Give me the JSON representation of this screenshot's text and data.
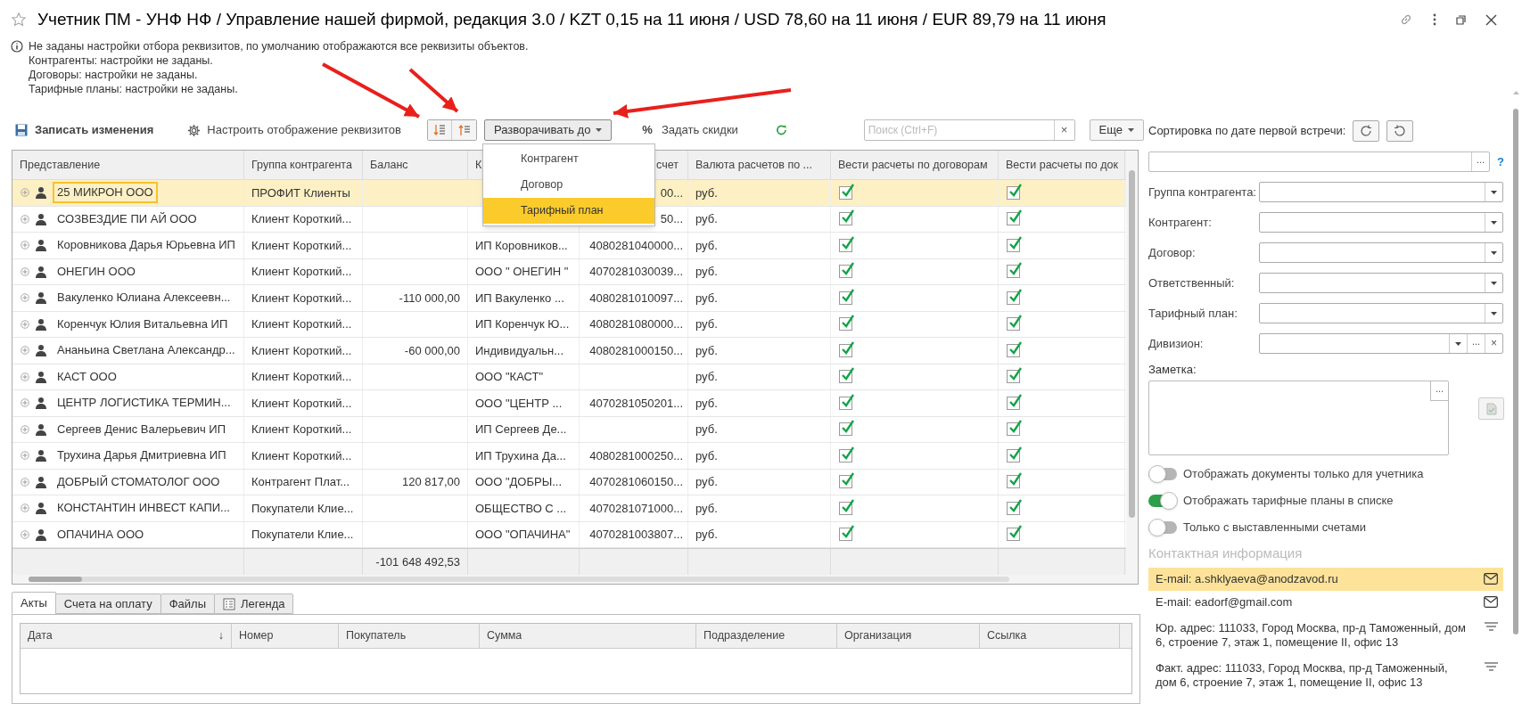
{
  "window": {
    "title": "Учетник ПМ - УНФ НФ / Управление нашей фирмой, редакция 3.0 / KZT 0,15 на 11 июня / USD 78,60 на 11 июня / EUR 89,79 на 11 июня"
  },
  "info_lines": [
    "Не заданы настройки отбора реквизитов, по умолчанию отображаются все реквизиты объектов.",
    "Контрагенты: настройки не заданы.",
    "Договоры: настройки не заданы.",
    "Тарифные планы: настройки не заданы."
  ],
  "toolbar": {
    "save": "Записать изменения",
    "settings": "Настроить отображение реквизитов",
    "expand": "Разворачивать до",
    "discount_mark": "%",
    "discounts": "Задать скидки",
    "search_placeholder": "Поиск (Ctrl+F)",
    "search_clear": "×",
    "more": "Еще"
  },
  "expand_menu": [
    {
      "label": "Контрагент",
      "selected": false
    },
    {
      "label": "Договор",
      "selected": false
    },
    {
      "label": "Тарифный план",
      "selected": true
    }
  ],
  "table": {
    "columns": [
      "Представление",
      "Группа контрагента",
      "Баланс",
      "К",
      "счет",
      "Валюта расчетов по ...",
      "Вести расчеты по договорам",
      "Вести расчеты по док"
    ],
    "rows": [
      {
        "name": "25 МИКРОН ООО",
        "group": "ПРОФИТ Клиенты",
        "balance": "",
        "column_5": "00...",
        "currency": "руб.",
        "by_contracts": true,
        "by_documents": true,
        "selected": true
      },
      {
        "name": "СОЗВЕЗДИЕ ПИ АЙ ООО",
        "group": "Клиент Короткий...",
        "balance": "",
        "column_5": "50...",
        "currency": "руб.",
        "by_contracts": true,
        "by_documents": true,
        "selected": false
      },
      {
        "name": "Коровникова Дарья Юрьевна ИП",
        "group": "Клиент Короткий...",
        "balance": "",
        "column_4": "ИП Коровников...",
        "column_5": "4080281040000...",
        "currency": "руб.",
        "by_contracts": true,
        "by_documents": true,
        "selected": false
      },
      {
        "name": "ОНЕГИН  ООО",
        "group": "Клиент Короткий...",
        "balance": "",
        "column_4": "ООО \" ОНЕГИН \"",
        "column_5": "4070281030039...",
        "currency": "руб.",
        "by_contracts": true,
        "by_documents": true,
        "selected": false
      },
      {
        "name": "Вакуленко Юлиана Алексеевн...",
        "group": "Клиент Короткий...",
        "balance": "-110 000,00",
        "column_4": "ИП Вакуленко ...",
        "column_5": "4080281010097...",
        "currency": "руб.",
        "by_contracts": true,
        "by_documents": true,
        "selected": false
      },
      {
        "name": "Коренчук Юлия Витальевна ИП",
        "group": "Клиент Короткий...",
        "balance": "",
        "column_4": "ИП Коренчук Ю...",
        "column_5": "4080281080000...",
        "currency": "руб.",
        "by_contracts": true,
        "by_documents": true,
        "selected": false
      },
      {
        "name": "Ананьина Светлана Александр...",
        "group": "Клиент Короткий...",
        "balance": "-60 000,00",
        "column_4": "Индивидуальн...",
        "column_5": "4080281000150...",
        "currency": "руб.",
        "by_contracts": true,
        "by_documents": true,
        "selected": false
      },
      {
        "name": "КАСТ ООО",
        "group": "Клиент Короткий...",
        "balance": "",
        "column_4": "ООО \"КАСТ\"",
        "column_5": "",
        "currency": "руб.",
        "by_contracts": true,
        "by_documents": true,
        "selected": false
      },
      {
        "name": "ЦЕНТР ЛОГИСТИКА ТЕРМИН...",
        "group": "Клиент Короткий...",
        "balance": "",
        "column_4": "ООО \"ЦЕНТР ...",
        "column_5": "4070281050201...",
        "currency": "руб.",
        "by_contracts": true,
        "by_documents": true,
        "selected": false
      },
      {
        "name": "Сергеев Денис Валерьевич ИП",
        "group": "Клиент Короткий...",
        "balance": "",
        "column_4": "ИП Сергеев Де...",
        "column_5": "",
        "currency": "руб.",
        "by_contracts": true,
        "by_documents": true,
        "selected": false
      },
      {
        "name": "Трухина Дарья Дмитриевна ИП",
        "group": "Клиент Короткий...",
        "balance": "",
        "column_4": "ИП Трухина Да...",
        "column_5": "4080281000250...",
        "currency": "руб.",
        "by_contracts": true,
        "by_documents": true,
        "selected": false
      },
      {
        "name": "ДОБРЫЙ СТОМАТОЛОГ ООО",
        "group": "Контрагент Плат...",
        "balance": "120 817,00",
        "column_4": "ООО \"ДОБРЫ...",
        "column_5": "4070281060150...",
        "currency": "руб.",
        "by_contracts": true,
        "by_documents": true,
        "selected": false
      },
      {
        "name": "КОНСТАНТИН ИНВЕСТ КАПИ...",
        "group": "Покупатели Клие...",
        "balance": "",
        "column_4": "ОБЩЕСТВО С ...",
        "column_5": "4070281071000...",
        "currency": "руб.",
        "by_contracts": true,
        "by_documents": true,
        "selected": false
      },
      {
        "name": "ОПАЧИНА ООО",
        "group": "Покупатели Клие...",
        "balance": "",
        "column_4": "ООО \"ОПАЧИНА\"",
        "column_5": "4070281003807...",
        "currency": "руб.",
        "by_contracts": true,
        "by_documents": true,
        "selected": false
      }
    ],
    "footer_balance": "-101 648 492,53"
  },
  "right_panel": {
    "sort_label": "Сортировка по дате первой встречи:",
    "top_field": {
      "dots": "...",
      "help": "?"
    },
    "filters": [
      {
        "label": "Группа контрагента:",
        "kind": "select"
      },
      {
        "label": "Контрагент:",
        "kind": "select"
      },
      {
        "label": "Договор:",
        "kind": "select"
      },
      {
        "label": "Ответственный:",
        "kind": "select"
      },
      {
        "label": "Тарифный план:",
        "kind": "select"
      },
      {
        "label": "Дивизион:",
        "kind": "reference",
        "dots": "...",
        "clear": "×"
      }
    ],
    "note": {
      "label": "Заметка:",
      "dots": "..."
    },
    "toggles": [
      {
        "label": "Отображать документы только для учетника",
        "on": false
      },
      {
        "label": "Отображать тарифные планы в списке",
        "on": true
      },
      {
        "label": "Только с выставленными счетами",
        "on": false
      }
    ],
    "contacts_title": "Контактная информация",
    "contacts": [
      {
        "text": "E-mail: a.shklyaeva@anodzavod.ru",
        "kind": "email",
        "selected": true
      },
      {
        "text": "E-mail: eadorf@gmail.com",
        "kind": "email",
        "selected": false
      },
      {
        "text": "Юр. адрес: 111033, Город Москва, пр-д Таможенный, дом 6, строение 7, этаж 1, помещение II, офис 13",
        "kind": "address",
        "selected": false
      },
      {
        "text": "Факт. адрес: 111033, Город Москва, пр-д Таможенный, дом 6, строение 7, этаж 1, помещение II, офис 13",
        "kind": "address",
        "selected": false
      }
    ]
  },
  "bottom_tabs": [
    {
      "label": "Акты",
      "selected": true,
      "kind": "plain"
    },
    {
      "label": "Счета на оплату",
      "selected": false,
      "kind": "plain"
    },
    {
      "label": "Файлы",
      "selected": false,
      "kind": "plain"
    },
    {
      "label": "Легенда",
      "selected": false,
      "kind": "legend"
    }
  ],
  "bottom_table": {
    "columns": [
      "Дата",
      "Номер",
      "Покупатель",
      "Сумма",
      "Подразделение",
      "Организация",
      "Ссылка"
    ],
    "sort_mark": "↓"
  }
}
